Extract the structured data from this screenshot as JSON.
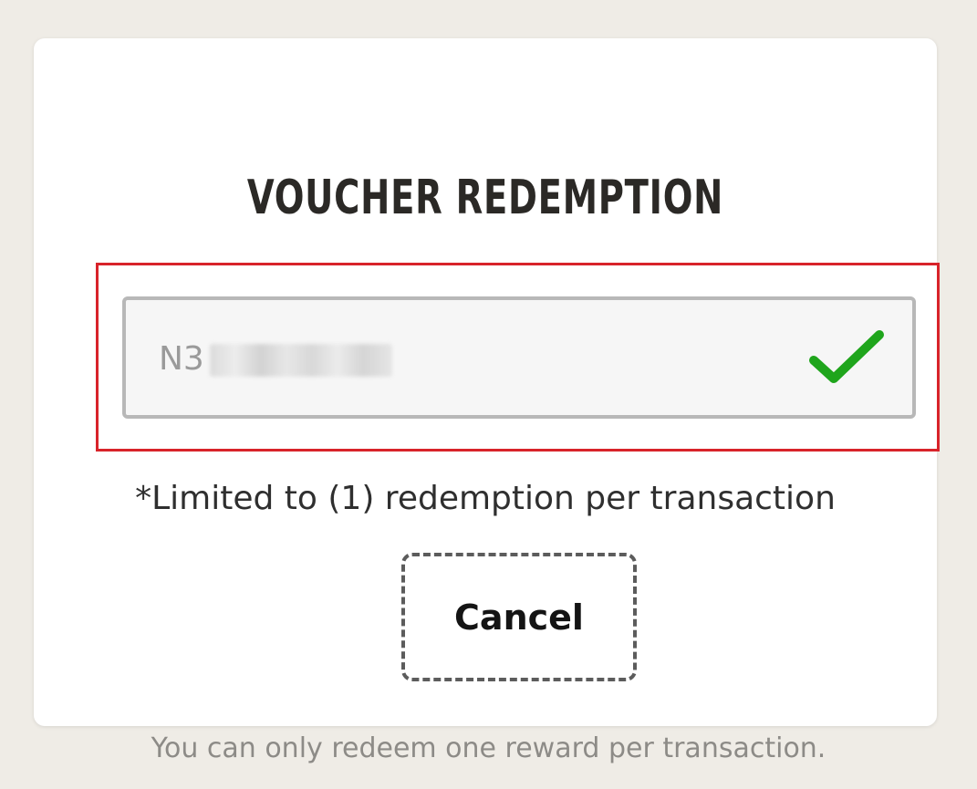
{
  "modal": {
    "title": "VOUCHER REDEMPTION",
    "voucher_input": {
      "value_visible": "N3",
      "status_icon": "checkmark-icon",
      "status_color": "#1fa51c"
    },
    "limit_note": "*Limited to (1) redemption per transaction",
    "cancel_label": "Cancel",
    "highlight_color": "#d8232a"
  },
  "footer": {
    "note": "You can only redeem one reward per transaction."
  }
}
